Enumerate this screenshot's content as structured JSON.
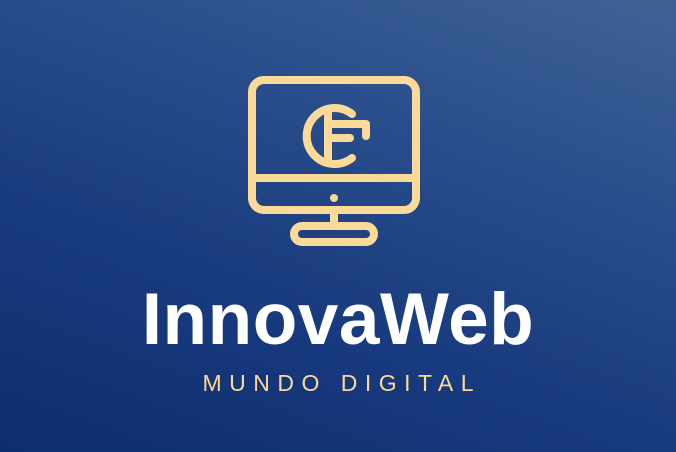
{
  "brand": {
    "name": "InnovaWeb",
    "tagline": "MUNDO DIGITAL"
  },
  "colors": {
    "background_start": "#3f6295",
    "background_end": "#0e2d6f",
    "accent": "#fbd998",
    "brand_text": "#ffffff"
  },
  "logo": {
    "icon": "desktop-monitor-icon"
  }
}
